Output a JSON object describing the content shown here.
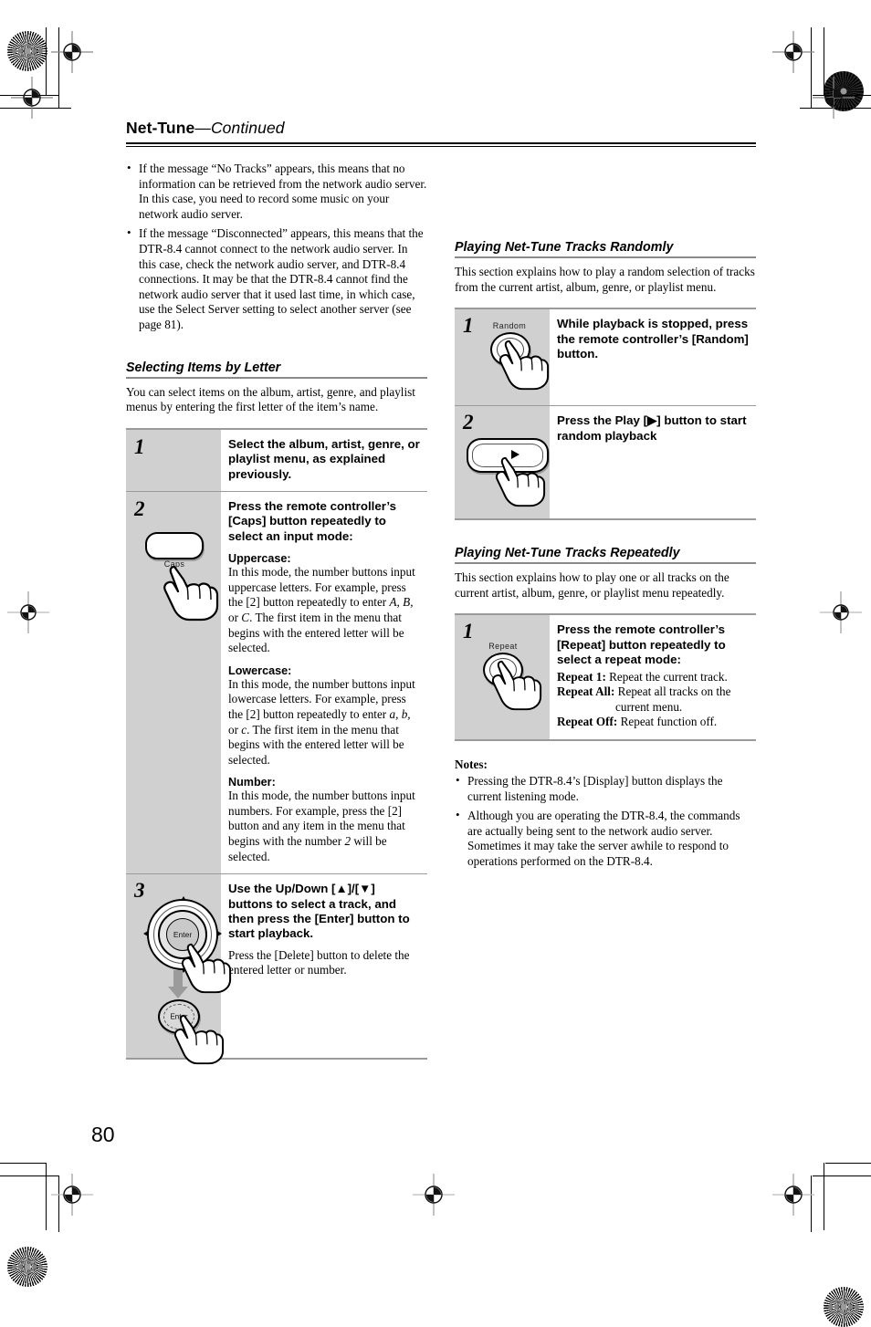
{
  "page": {
    "number": "80",
    "header_title": "Net-Tune",
    "header_continued": "—Continued"
  },
  "left_column": {
    "intro_bullets": [
      "If the message “No Tracks” appears, this means that no information can be retrieved from the network audio server. In this case, you need to record some music on your network audio server.",
      "If the message “Disconnected” appears, this means that the DTR-8.4 cannot connect to the network audio server. In this case, check the network audio server, and DTR-8.4 connections. It may be that the DTR-8.4 cannot find the network audio server that it used last time, in which case, use the Select Server setting to select another server (see page 81)."
    ],
    "section": {
      "heading": "Selecting Items by Letter",
      "lead": "You can select items on the album, artist, genre, and playlist menus by entering the first letter of the item’s name."
    },
    "steps": [
      {
        "number": "1",
        "title": "Select the album, artist, genre, or playlist menu, as explained previously.",
        "icon": "none"
      },
      {
        "number": "2",
        "title": "Press the remote controller’s [Caps] button repeatedly to select an input mode:",
        "icon": "caps-button",
        "icon_label": "Caps",
        "blocks": [
          {
            "label": "Uppercase:",
            "text_parts": [
              {
                "t": "In this mode, the number buttons input uppercase letters. For example, press the [2] button repeatedly to enter ",
                "style": "normal"
              },
              {
                "t": "A, B,",
                "style": "italic"
              },
              {
                "t": " or ",
                "style": "normal"
              },
              {
                "t": "C",
                "style": "italic"
              },
              {
                "t": ". The first item in the menu that begins with the entered letter will be selected.",
                "style": "normal"
              }
            ]
          },
          {
            "label": "Lowercase:",
            "text_parts": [
              {
                "t": "In this mode, the number buttons input lowercase letters. For example, press the [2] button repeatedly to enter ",
                "style": "normal"
              },
              {
                "t": "a, b,",
                "style": "italic"
              },
              {
                "t": " or ",
                "style": "normal"
              },
              {
                "t": "c",
                "style": "italic"
              },
              {
                "t": ". The first item in the menu that begins with the entered letter will be selected.",
                "style": "normal"
              }
            ]
          },
          {
            "label": "Number:",
            "text_parts": [
              {
                "t": "In this mode, the number buttons input numbers. For example, press the [2] button and any item in the menu that begins with the number ",
                "style": "normal"
              },
              {
                "t": "2",
                "style": "italic"
              },
              {
                "t": " will be selected.",
                "style": "normal"
              }
            ]
          }
        ]
      },
      {
        "number": "3",
        "title": "Use the Up/Down [▲]/[▼] buttons to select a track, and then press the [Enter] button to start playback.",
        "icon": "jog-wheel-enter",
        "icon_label": "Enter",
        "body": "Press the [Delete] button to delete the entered letter or number."
      }
    ]
  },
  "right_column": {
    "random_section": {
      "heading": "Playing Net-Tune Tracks Randomly",
      "lead": "This section explains how to play a random selection of tracks from the current artist, album, genre, or playlist menu.",
      "steps": [
        {
          "number": "1",
          "title": "While playback is stopped, press the remote controller’s [Random] button.",
          "icon": "random-button",
          "icon_label": "Random"
        },
        {
          "number": "2",
          "title": "Press the Play [▶] button to start random playback",
          "icon": "play-button"
        }
      ]
    },
    "repeat_section": {
      "heading": "Playing Net-Tune Tracks Repeatedly",
      "lead": "This section explains how to play one or all tracks on the current artist, album, genre, or playlist menu repeatedly.",
      "steps": [
        {
          "number": "1",
          "title": "Press the remote controller’s [Repeat] button repeatedly to select a repeat mode:",
          "icon": "repeat-button",
          "icon_label": "Repeat",
          "modes": [
            {
              "label": "Repeat 1:",
              "desc": " Repeat the current track."
            },
            {
              "label": "Repeat All:",
              "desc": " Repeat all tracks on the"
            },
            {
              "label": "",
              "desc": "current menu."
            },
            {
              "label": "Repeat Off:",
              "desc": " Repeat function off."
            }
          ]
        }
      ]
    },
    "notes": {
      "heading": "Notes:",
      "items": [
        "Pressing the DTR-8.4’s [Display] button displays the current listening mode.",
        "Although you are operating the DTR-8.4, the commands are actually being sent to the network audio server. Sometimes it may take the server awhile to respond to operations performed on the DTR-8.4."
      ]
    }
  },
  "colors": {
    "step_number_cell": "#d0d0d0",
    "rule": "#9a9a9a",
    "text": "#000000",
    "background": "#ffffff"
  }
}
